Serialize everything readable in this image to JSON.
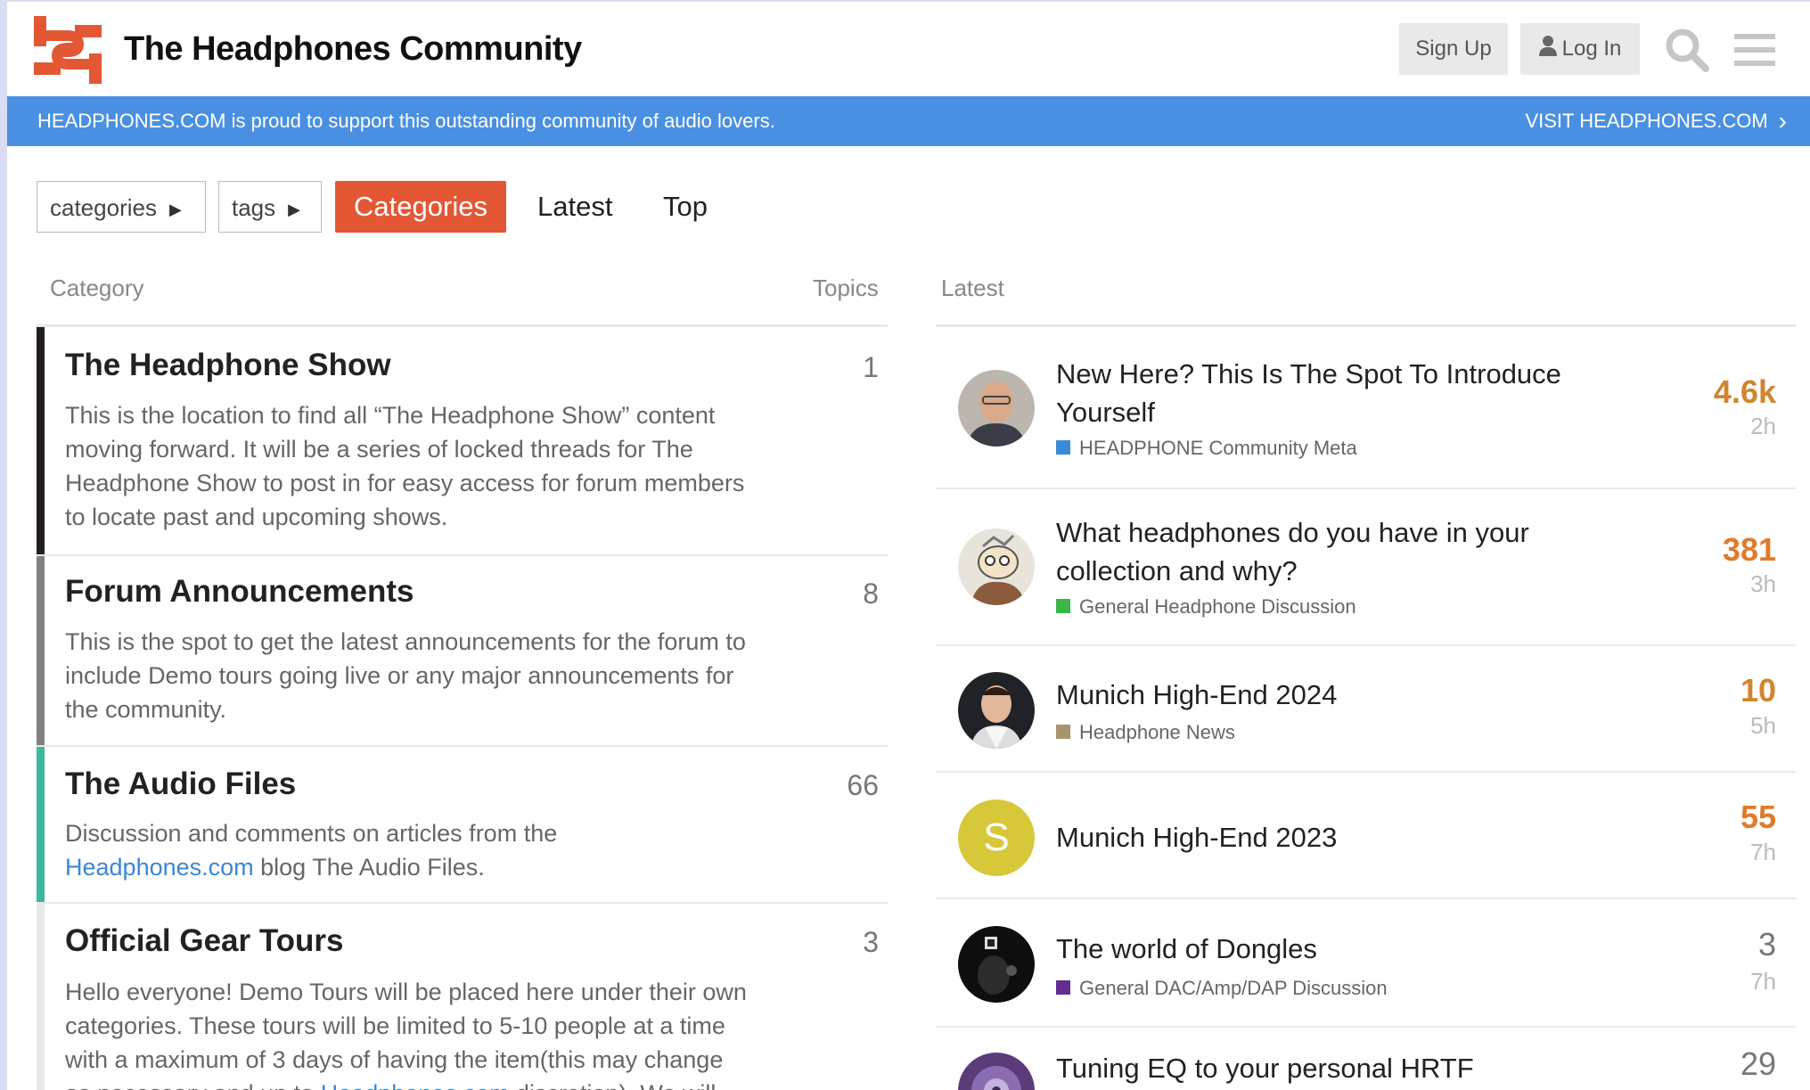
{
  "header": {
    "site_title": "The Headphones Community",
    "signup_label": "Sign Up",
    "login_label": "Log In",
    "brand_color": "#e45735"
  },
  "banner": {
    "text": "HEADPHONES.COM is proud to support this outstanding community of audio lovers.",
    "link_label": "VISIT HEADPHONES.COM",
    "color": "#4a90e2"
  },
  "nav": {
    "categories_dropdown": "categories",
    "tags_dropdown": "tags",
    "tabs": [
      {
        "label": "Categories",
        "active": true
      },
      {
        "label": "Latest",
        "active": false
      },
      {
        "label": "Top",
        "active": false
      }
    ]
  },
  "columns": {
    "category": "Category",
    "topics": "Topics",
    "latest": "Latest"
  },
  "categories": [
    {
      "title": "The Headphone Show",
      "description": "This is the location to find all “The Headphone Show” content moving forward. It will be a series of locked threads for The Headphone Show to post in for easy access for forum members to locate past and upcoming shows.",
      "topics": "1",
      "color": "#231f20"
    },
    {
      "title": "Forum Announcements",
      "description": "This is the spot to get the latest announcements for the forum to include Demo tours going live or any major announcements for the community.",
      "topics": "8",
      "color": "#808281"
    },
    {
      "title": "The Audio Files",
      "description_pre": "Discussion and comments on articles from the ",
      "description_link": "Headphones.com",
      "description_post": " blog The Audio Files.",
      "topics": "66",
      "color": "#3ab99b"
    },
    {
      "title": "Official Gear Tours",
      "description_pre": "Hello everyone! Demo Tours will be placed here under their own categories. These tours will be limited to 5-10 people at a time with a maximum of 3 days of having the item(this may change as necessary and up to ",
      "description_link": "Headphones.com",
      "description_post": " discretion). We will",
      "topics": "3",
      "color": "#e9e9e9"
    }
  ],
  "latest_topics": [
    {
      "title": "New Here? This Is The Spot To Introduce Yourself",
      "category": "HEADPHONE Community Meta",
      "category_color": "#3b8ad8",
      "posts": "4.6k",
      "posts_color": "#d2852e",
      "age": "2h",
      "avatar": "photo"
    },
    {
      "title": "What headphones do you have in your collection and why?",
      "category": "General Headphone Discussion",
      "category_color": "#3ab54a",
      "posts": "381",
      "posts_color": "#e07b2c",
      "age": "3h",
      "avatar": "cartoon"
    },
    {
      "title": "Munich High-End 2024",
      "category": "Headphone News",
      "category_color": "#a8956b",
      "posts": "10",
      "posts_color": "#d2852e",
      "age": "5h",
      "avatar": "photo"
    },
    {
      "title": "Munich High-End 2023",
      "category": "",
      "category_color": "",
      "posts": "55",
      "posts_color": "#e07b2c",
      "age": "7h",
      "avatar": "S"
    },
    {
      "title": "The world of Dongles",
      "category": "General DAC/Amp/DAP Discussion",
      "category_color": "#652d90",
      "posts": "3",
      "posts_color": "#777777",
      "age": "7h",
      "avatar": "photo"
    },
    {
      "title": "Tuning EQ to your personal HRTF",
      "category": "",
      "category_color": "",
      "posts": "29",
      "posts_color": "#777777",
      "age": "",
      "avatar": "photo"
    }
  ]
}
